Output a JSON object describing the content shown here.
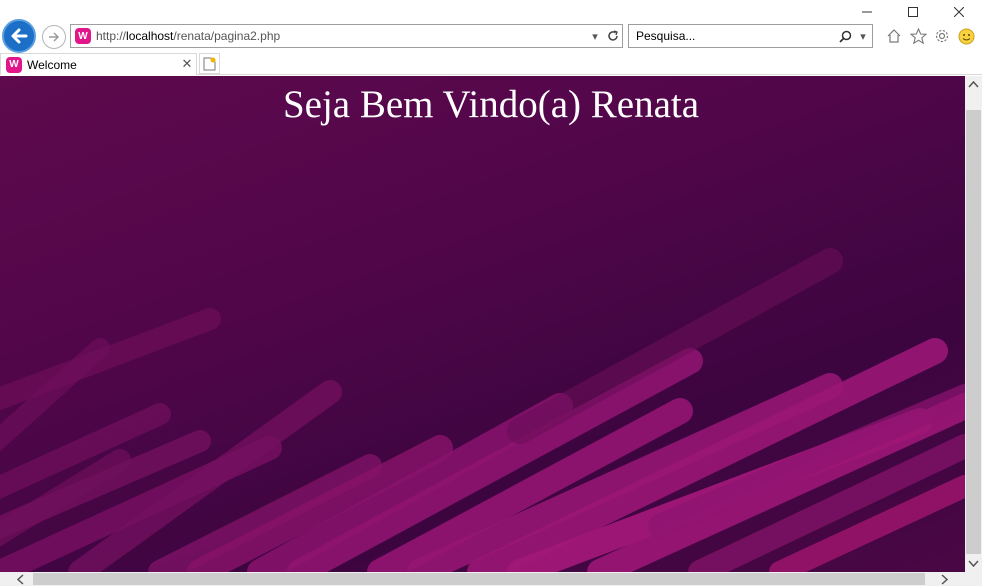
{
  "browser": {
    "address_bar": {
      "scheme": "http://",
      "host": "localhost",
      "path": "/renata/pagina2.php"
    },
    "search": {
      "placeholder": "Pesquisa..."
    },
    "tab": {
      "title": "Welcome"
    },
    "favicon_letter": "W"
  },
  "page": {
    "heading": "Seja Bem Vindo(a) Renata"
  },
  "colors": {
    "background": "#52064a",
    "accent_stripes": "#a3156f",
    "heading_text": "#ffffff"
  }
}
